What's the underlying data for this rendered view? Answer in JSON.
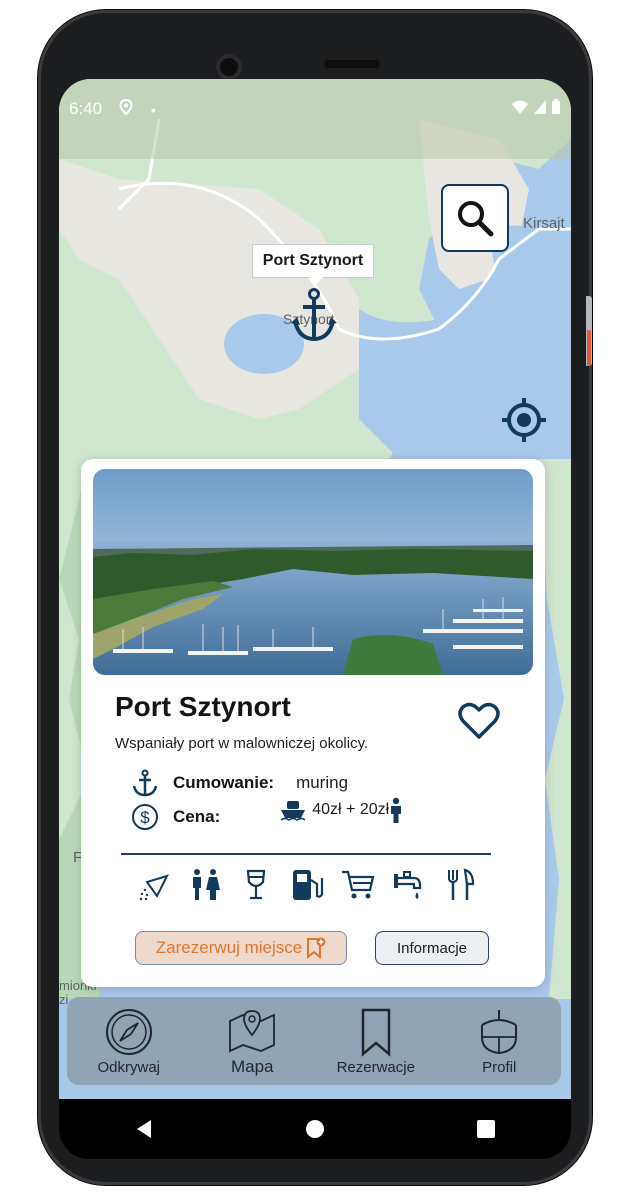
{
  "status_bar": {
    "time": "6:40",
    "dot": "•"
  },
  "map": {
    "labels": {
      "kirsajty": "Kirsajt",
      "sztynort": "Sztynort",
      "left_edge": "F",
      "bottom_left": "mionki\nzi"
    },
    "selected_port": "Port Sztynort"
  },
  "card": {
    "title": "Port Sztynort",
    "description": "Wspaniały port w malowniczej okolicy.",
    "mooring": {
      "label": "Cumowanie:",
      "value": "muring"
    },
    "price": {
      "label": "Cena:",
      "value": "40zł + 20zł"
    },
    "amenities": [
      "shower-icon",
      "toilet-icon",
      "bar-icon",
      "fuel-icon",
      "shop-icon",
      "water-tap-icon",
      "restaurant-icon"
    ],
    "reserve_button": "Zarezerwuj miejsce",
    "info_button": "Informacje"
  },
  "bottom_nav": [
    {
      "label": "Odkrywaj",
      "icon": "compass-icon"
    },
    {
      "label": "Mapa",
      "icon": "map-icon"
    },
    {
      "label": "Rezerwacje",
      "icon": "bookmark-icon"
    },
    {
      "label": "Profil",
      "icon": "boat-icon"
    }
  ],
  "colors": {
    "accent": "#e0742e",
    "navy": "#123a5c",
    "nav_bg": "#8fa4b5"
  }
}
